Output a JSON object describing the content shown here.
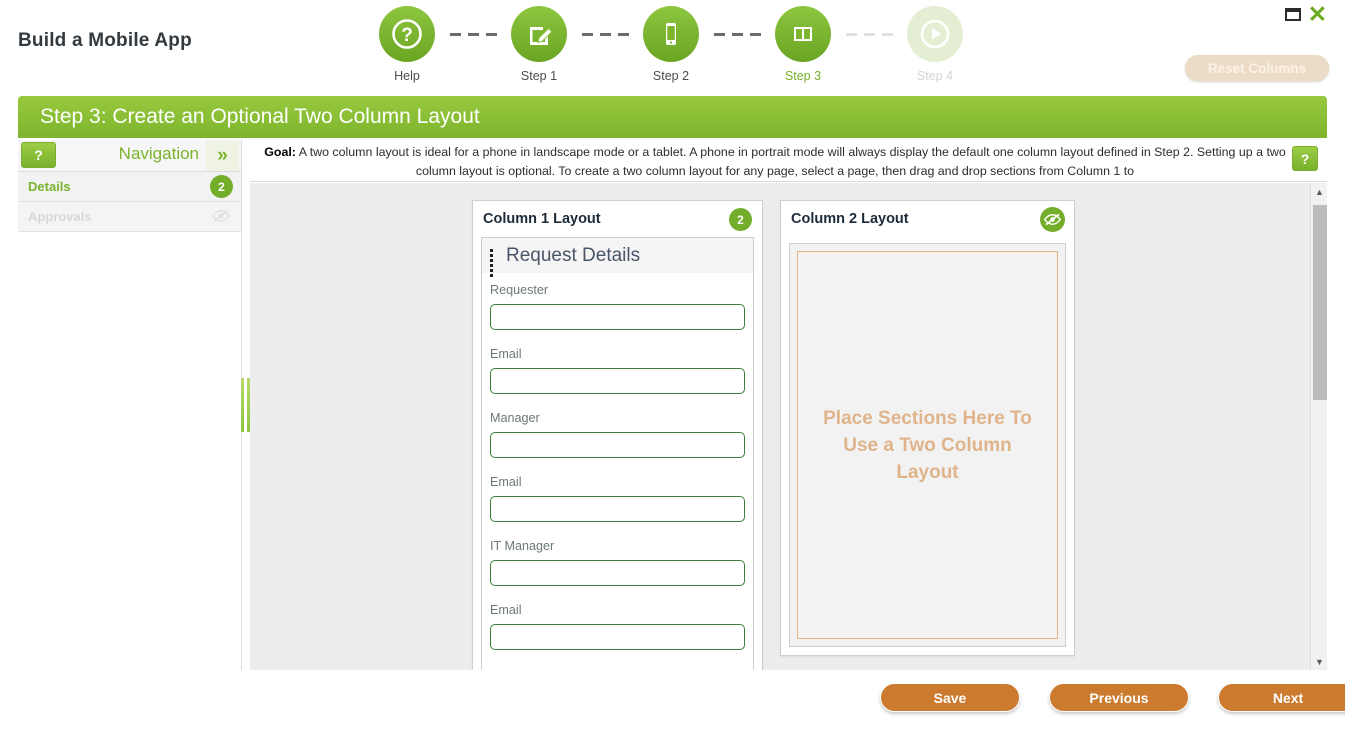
{
  "window": {
    "restore_icon": "restore-icon",
    "close_icon": "close-icon"
  },
  "header": {
    "app_title": "Build a Mobile App",
    "reset_button": "Reset Columns",
    "step_header": "Step 3: Create an Optional Two Column Layout",
    "accent_green": "#8dc63f",
    "accent_orange": "#cb7a2e"
  },
  "stepper": {
    "steps": [
      {
        "label": "Help",
        "icon": "question-mark-circle-icon",
        "state": "done"
      },
      {
        "label": "Step 1",
        "icon": "edit-pencil-icon",
        "state": "done"
      },
      {
        "label": "Step 2",
        "icon": "mobile-phone-icon",
        "state": "done"
      },
      {
        "label": "Step 3",
        "icon": "two-column-layout-icon",
        "state": "current"
      },
      {
        "label": "Step 4",
        "icon": "play-circle-icon",
        "state": "disabled"
      }
    ]
  },
  "sidebar": {
    "help_button": "?",
    "title": "Navigation",
    "collapse_icon": "chevron-double-right-icon",
    "items": [
      {
        "label": "Details",
        "badge": "2",
        "state": "active"
      },
      {
        "label": "Approvals",
        "icon": "eye-slash-icon",
        "state": "hidden"
      }
    ]
  },
  "goal": {
    "label": "Goal:",
    "text": "A two column layout is ideal for a phone in landscape mode or a tablet. A phone in portrait mode will always display the default one column layout defined in Step 2. Setting up a two column layout is optional. To create a two column layout for any page, select a page, then drag and drop sections from Column 1 to",
    "help_button": "?"
  },
  "columns": {
    "column1": {
      "title": "Column 1 Layout",
      "badge": "2",
      "section": {
        "title": "Request Details",
        "grip_icon": "drag-grip-icon",
        "fields": [
          {
            "label": "Requester",
            "value": ""
          },
          {
            "label": "Email",
            "value": ""
          },
          {
            "label": "Manager",
            "value": ""
          },
          {
            "label": "Email",
            "value": ""
          },
          {
            "label": "IT Manager",
            "value": ""
          },
          {
            "label": "Email",
            "value": ""
          }
        ]
      }
    },
    "column2": {
      "title": "Column 2 Layout",
      "visibility_icon": "eye-slash-icon",
      "dropzone_text": "Place Sections Here To Use a Two Column Layout"
    }
  },
  "scrollbar": {
    "up_icon": "caret-up-icon",
    "down_icon": "caret-down-icon"
  },
  "footer": {
    "save": "Save",
    "previous": "Previous",
    "next": "Next"
  }
}
